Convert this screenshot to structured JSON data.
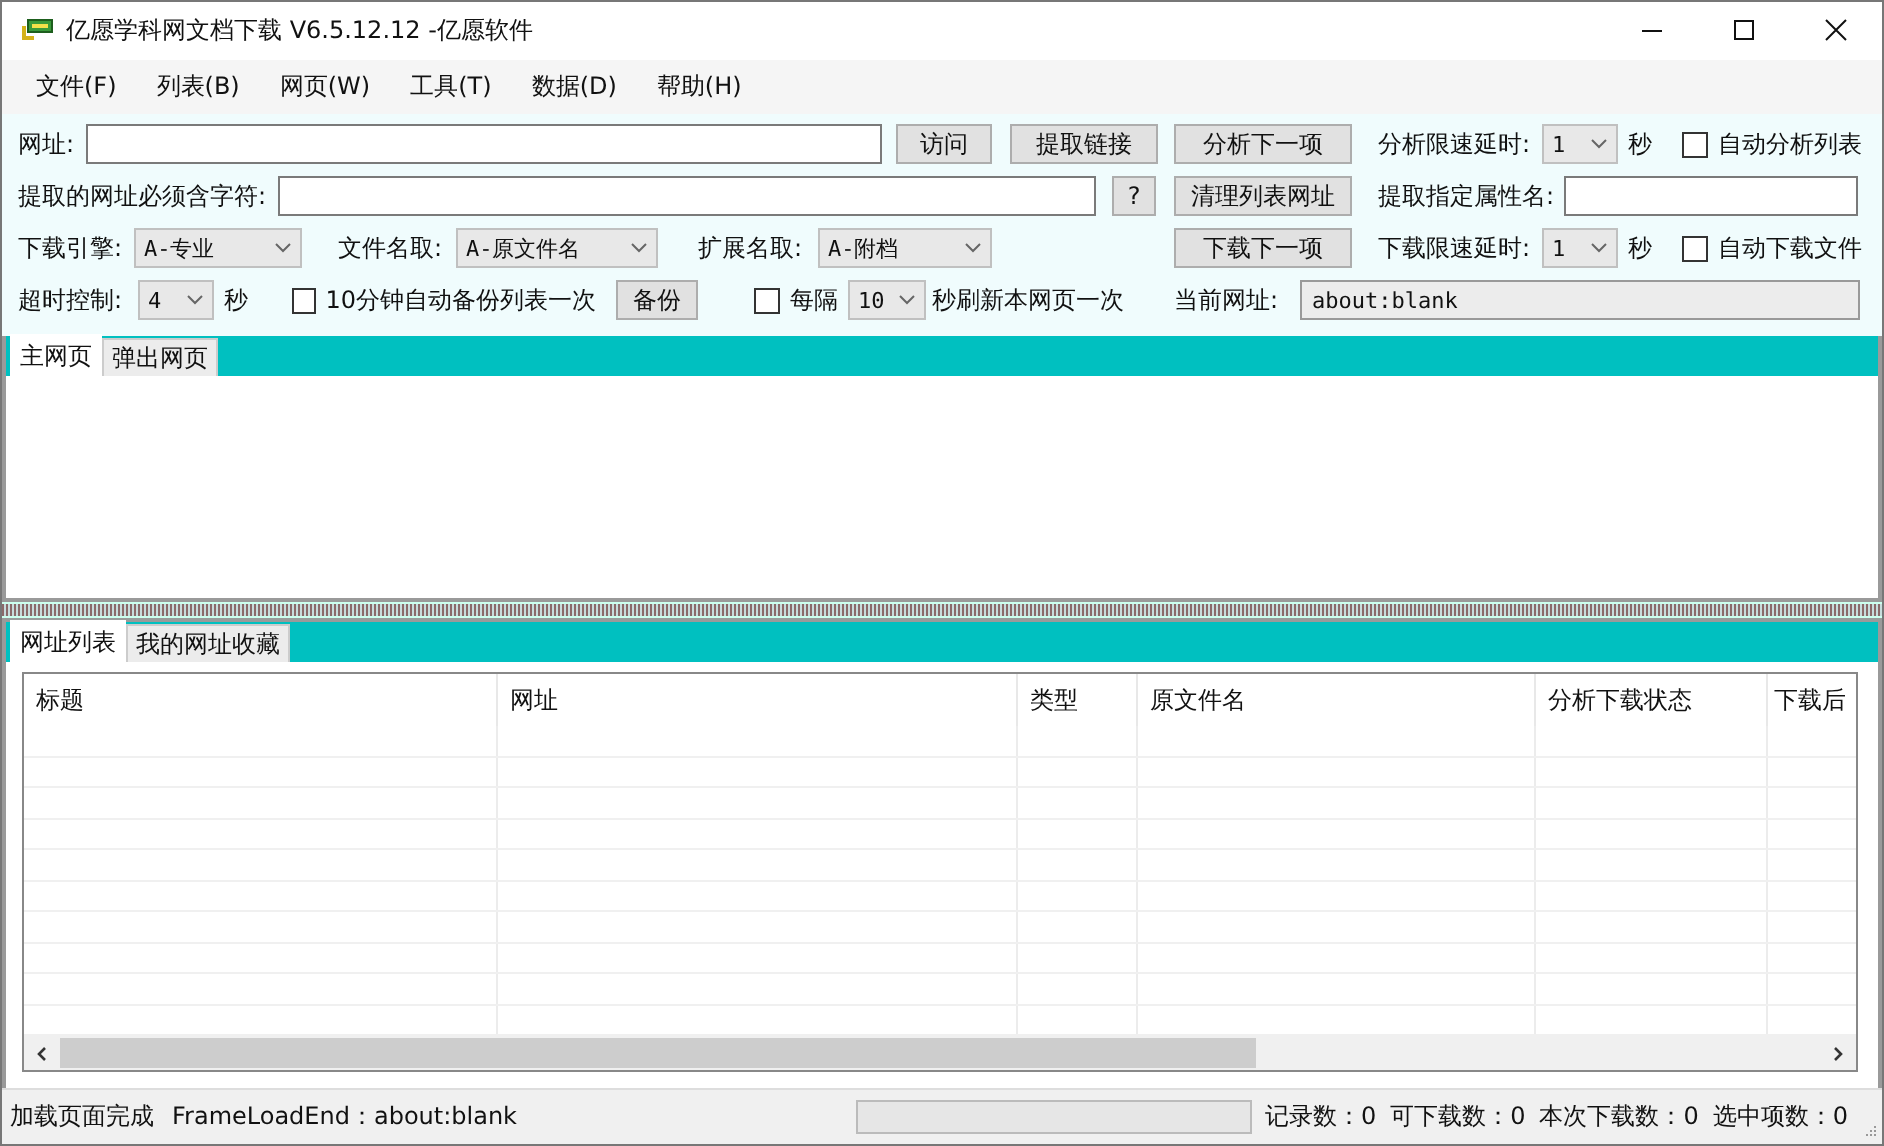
{
  "window": {
    "title": "亿愿学科网文档下载 V6.5.12.12 -亿愿软件"
  },
  "menu": [
    "文件(F)",
    "列表(B)",
    "网页(W)",
    "工具(T)",
    "数据(D)",
    "帮助(H)"
  ],
  "toolbar": {
    "rows": [
      {
        "left": [
          {
            "kind": "label",
            "text": "网址:"
          },
          {
            "kind": "input"
          },
          {
            "kind": "button",
            "label": "访问"
          },
          {
            "kind": "button",
            "label": "提取链接"
          }
        ],
        "right": [
          {
            "kind": "button",
            "label": "分析下一项"
          },
          {
            "kind": "label",
            "text": "分析限速延时:"
          },
          {
            "kind": "select",
            "value": "1"
          },
          {
            "kind": "label",
            "text": "秒"
          },
          {
            "kind": "checkbox",
            "label": "自动分析列表",
            "checked": false
          }
        ]
      },
      {
        "left": [
          {
            "kind": "label",
            "text": "提取的网址必须含字符:"
          },
          {
            "kind": "input"
          },
          {
            "kind": "button",
            "label": "?"
          }
        ],
        "right": [
          {
            "kind": "button",
            "label": "清理列表网址"
          },
          {
            "kind": "label",
            "text": "提取指定属性名:"
          },
          {
            "kind": "input"
          }
        ]
      },
      {
        "left": [
          {
            "kind": "label",
            "text": "下载引擎:"
          },
          {
            "kind": "select",
            "value": "A-专业"
          },
          {
            "kind": "label",
            "text": "文件名取:"
          },
          {
            "kind": "select",
            "value": "A-原文件名"
          },
          {
            "kind": "label",
            "text": "扩展名取:"
          },
          {
            "kind": "select",
            "value": "A-附档"
          }
        ],
        "right": [
          {
            "kind": "button",
            "label": "下载下一项"
          },
          {
            "kind": "label",
            "text": "下载限速延时:"
          },
          {
            "kind": "select",
            "value": "1"
          },
          {
            "kind": "label",
            "text": "秒"
          },
          {
            "kind": "checkbox",
            "label": "自动下载文件",
            "checked": false
          }
        ]
      },
      {
        "left": [
          {
            "kind": "label",
            "text": "超时控制:"
          },
          {
            "kind": "select",
            "value": "4"
          },
          {
            "kind": "label",
            "text": "秒"
          },
          {
            "kind": "checkbox",
            "label": "10分钟自动备份列表一次",
            "checked": false
          },
          {
            "kind": "button",
            "label": "备份"
          },
          {
            "kind": "checkbox",
            "label": "每隔",
            "checked": false
          },
          {
            "kind": "select",
            "value": "10"
          },
          {
            "kind": "label",
            "text": "秒刷新本网页一次"
          }
        ],
        "right": [
          {
            "kind": "label",
            "text": "当前网址:"
          },
          {
            "kind": "field",
            "value": "about:blank"
          }
        ]
      }
    ]
  },
  "browser_tabs": [
    {
      "label": "主网页",
      "selected": true
    },
    {
      "label": "弹出网页",
      "selected": false
    }
  ],
  "list_tabs": [
    {
      "label": "网址列表",
      "selected": true
    },
    {
      "label": "我的网址收藏",
      "selected": false
    }
  ],
  "table": {
    "columns": [
      "标题",
      "网址",
      "类型",
      "原文件名",
      "分析下载状态",
      "下载后"
    ]
  },
  "status_bar": {
    "messages": [
      "加载页面完成",
      "FrameLoadEnd：about:blank"
    ],
    "progress": {
      "level": 0
    },
    "counters": [
      "记录数：0",
      "可下载数：0",
      "本次下载数：0",
      "选中项数：0"
    ]
  }
}
